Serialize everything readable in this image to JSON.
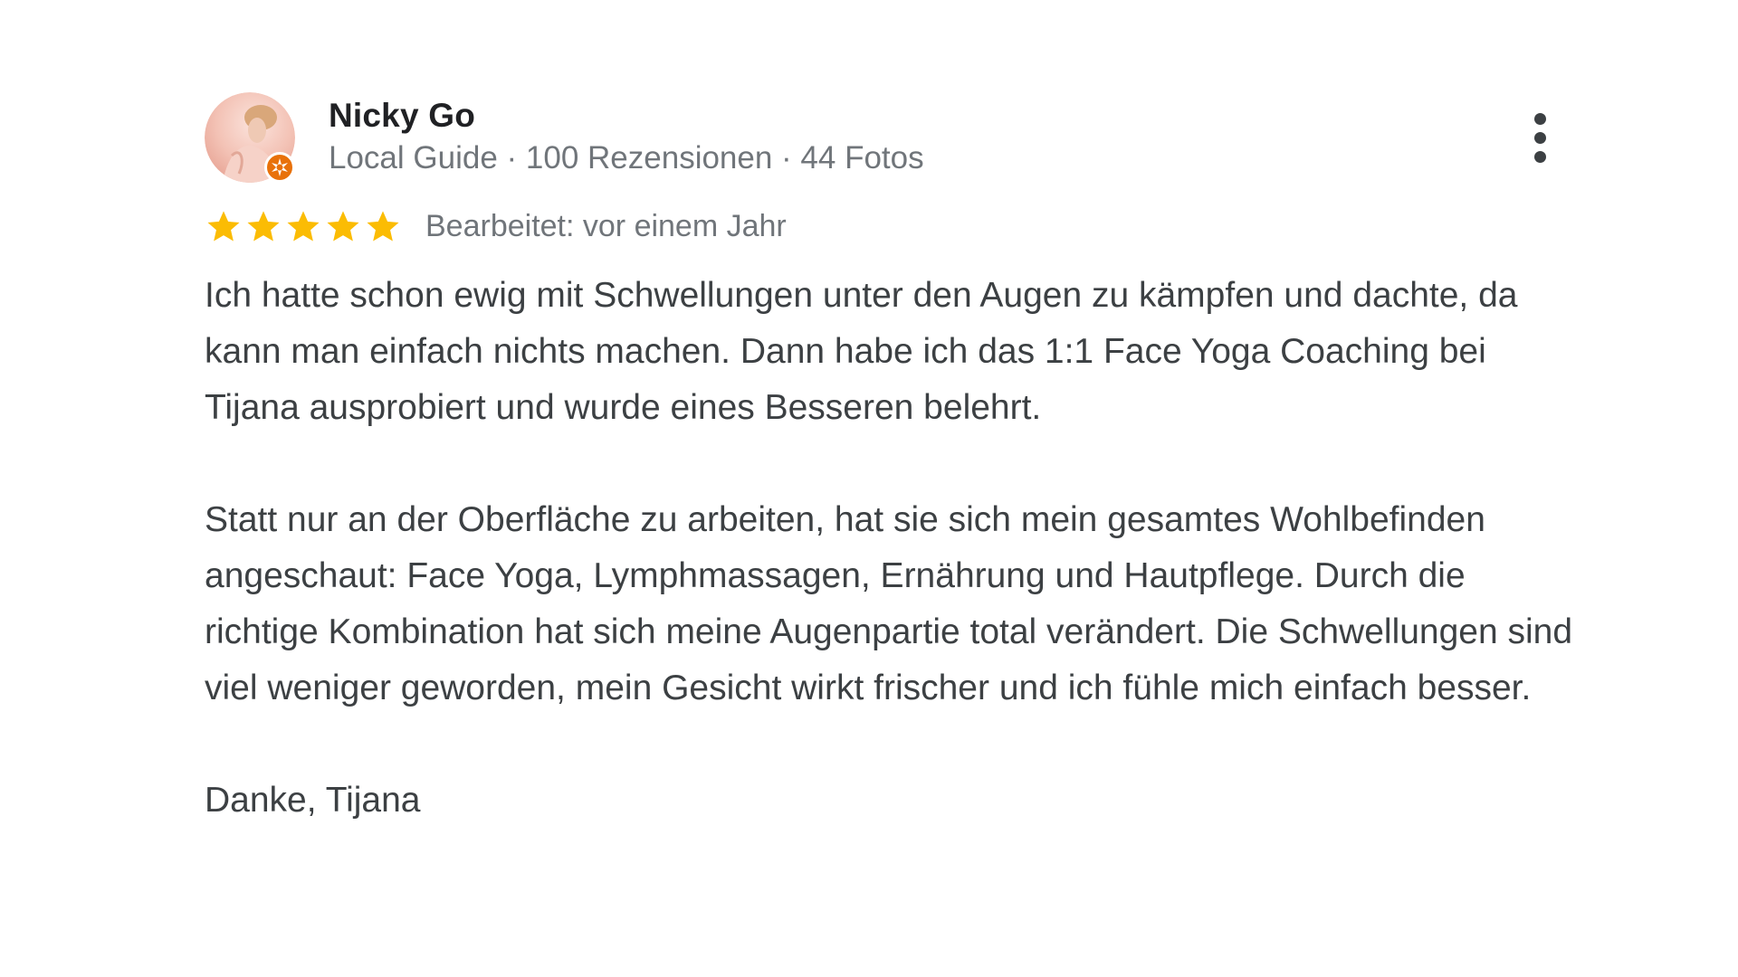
{
  "review": {
    "author": {
      "name": "Nicky Go",
      "meta": "Local Guide · 100 Rezensionen · 44 Fotos",
      "avatar": "avatar-photo",
      "badge": "local-guide-badge"
    },
    "rating": {
      "stars": 5,
      "max_stars": 5,
      "star_color": "#fbbc04"
    },
    "edited_label": "Bearbeitet: vor einem Jahr",
    "more_icon": "more-vert-icon",
    "paragraphs": [
      "Ich hatte schon ewig mit Schwellungen unter den Augen zu kämpfen und dachte, da kann man einfach nichts machen. Dann habe ich das 1:1 Face Yoga Coaching bei Tijana ausprobiert und wurde eines Besseren belehrt.",
      "Statt nur an der Oberfläche zu arbeiten, hat sie sich mein gesamtes Wohlbefinden angeschaut: Face Yoga, Lymphmassagen, Ernährung und Hautpflege. Durch die richtige Kombination hat sich meine Augenpartie total verändert. Die Schwellungen sind viel weniger geworden, mein Gesicht wirkt frischer und ich fühle mich einfach besser.",
      "Danke, Tijana"
    ]
  },
  "colors": {
    "text_primary": "#202124",
    "text_body": "#3c4043",
    "text_secondary": "#70757a",
    "badge": "#e8710a",
    "star": "#fbbc04"
  }
}
